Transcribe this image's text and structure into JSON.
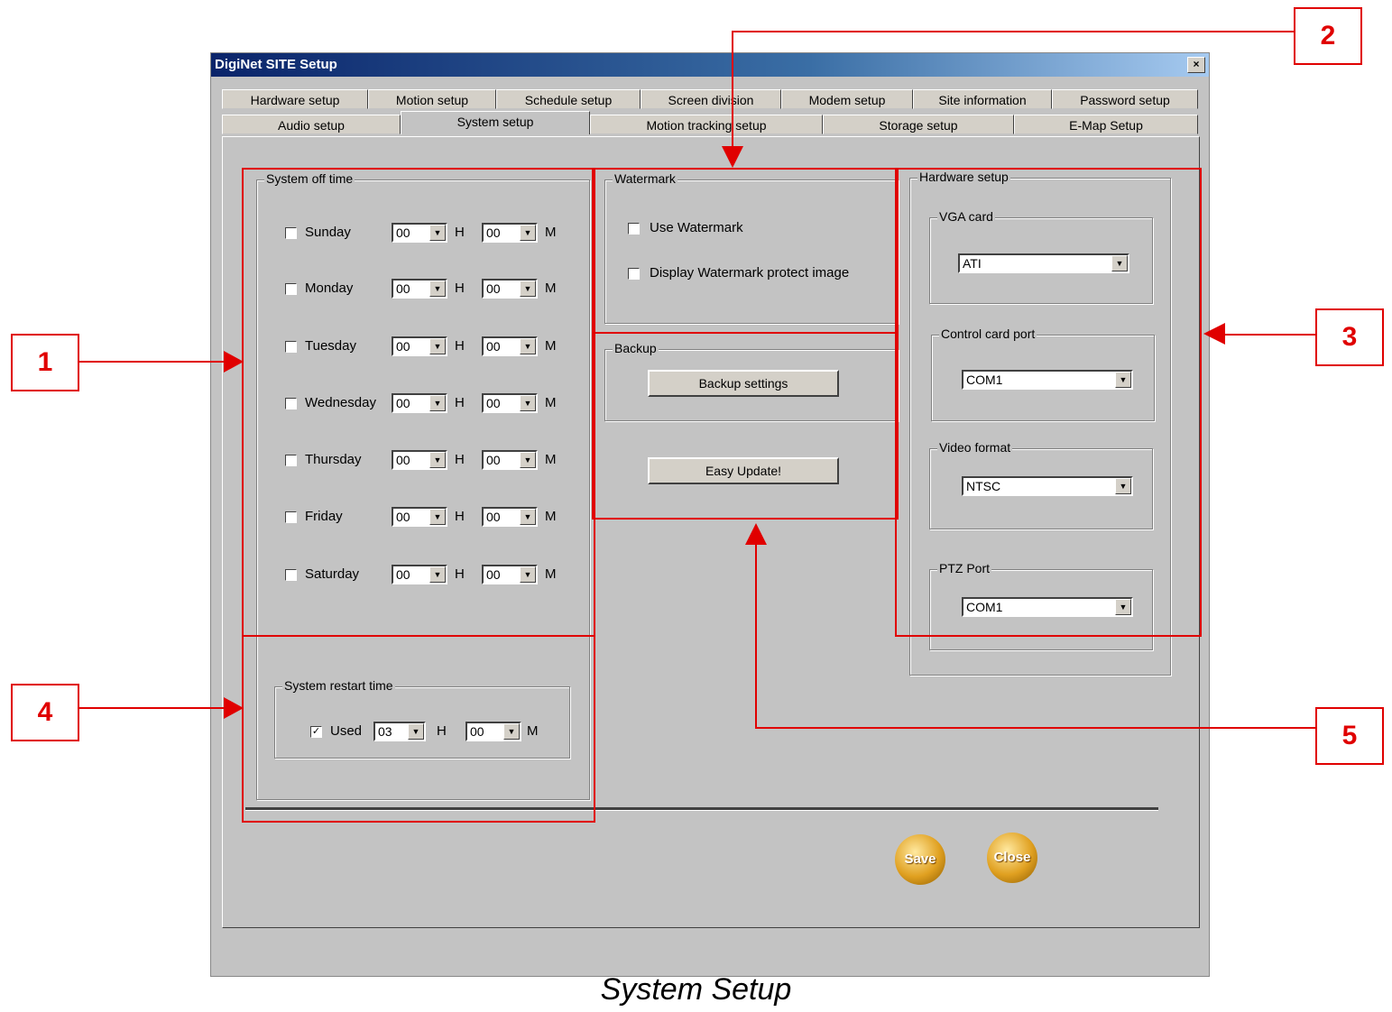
{
  "window": {
    "title": "DigiNet SITE Setup",
    "close_glyph": "×"
  },
  "tabs_row1": [
    "Hardware setup",
    "Motion setup",
    "Schedule setup",
    "Screen division",
    "Modem setup",
    "Site information",
    "Password setup"
  ],
  "tabs_row2": [
    "Audio setup",
    "System setup",
    "Motion tracking setup",
    "Storage setup",
    "E-Map Setup"
  ],
  "active_tab": "System setup",
  "system_off_time": {
    "label": "System off time",
    "days": [
      {
        "name": "Sunday",
        "checked": false,
        "hour": "00",
        "minute": "00"
      },
      {
        "name": "Monday",
        "checked": false,
        "hour": "00",
        "minute": "00"
      },
      {
        "name": "Tuesday",
        "checked": false,
        "hour": "00",
        "minute": "00"
      },
      {
        "name": "Wednesday",
        "checked": false,
        "hour": "00",
        "minute": "00"
      },
      {
        "name": "Thursday",
        "checked": false,
        "hour": "00",
        "minute": "00"
      },
      {
        "name": "Friday",
        "checked": false,
        "hour": "00",
        "minute": "00"
      },
      {
        "name": "Saturday",
        "checked": false,
        "hour": "00",
        "minute": "00"
      }
    ],
    "h_unit": "H",
    "m_unit": "M"
  },
  "system_restart_time": {
    "label": "System restart time",
    "used_label": "Used",
    "used_checked": true,
    "hour": "03",
    "minute": "00",
    "h_unit": "H",
    "m_unit": "M"
  },
  "watermark": {
    "label": "Watermark",
    "use_label": "Use Watermark",
    "display_label": "Display Watermark protect image"
  },
  "backup": {
    "label": "Backup",
    "settings_button": "Backup settings",
    "update_button": "Easy Update!"
  },
  "hardware_setup": {
    "label": "Hardware setup",
    "vga_card": {
      "label": "VGA card",
      "value": "ATI"
    },
    "control_card_port": {
      "label": "Control card port",
      "value": "COM1"
    },
    "video_format": {
      "label": "Video format",
      "value": "NTSC"
    },
    "ptz_port": {
      "label": "PTZ Port",
      "value": "COM1"
    }
  },
  "buttons": {
    "save": "Save",
    "close": "Close"
  },
  "callouts": [
    "1",
    "2",
    "3",
    "4",
    "5"
  ],
  "caption": "System Setup",
  "colors": {
    "annotation": "#e00000",
    "window_bg": "#c3c3c3",
    "titlebar": "#0a246a"
  }
}
